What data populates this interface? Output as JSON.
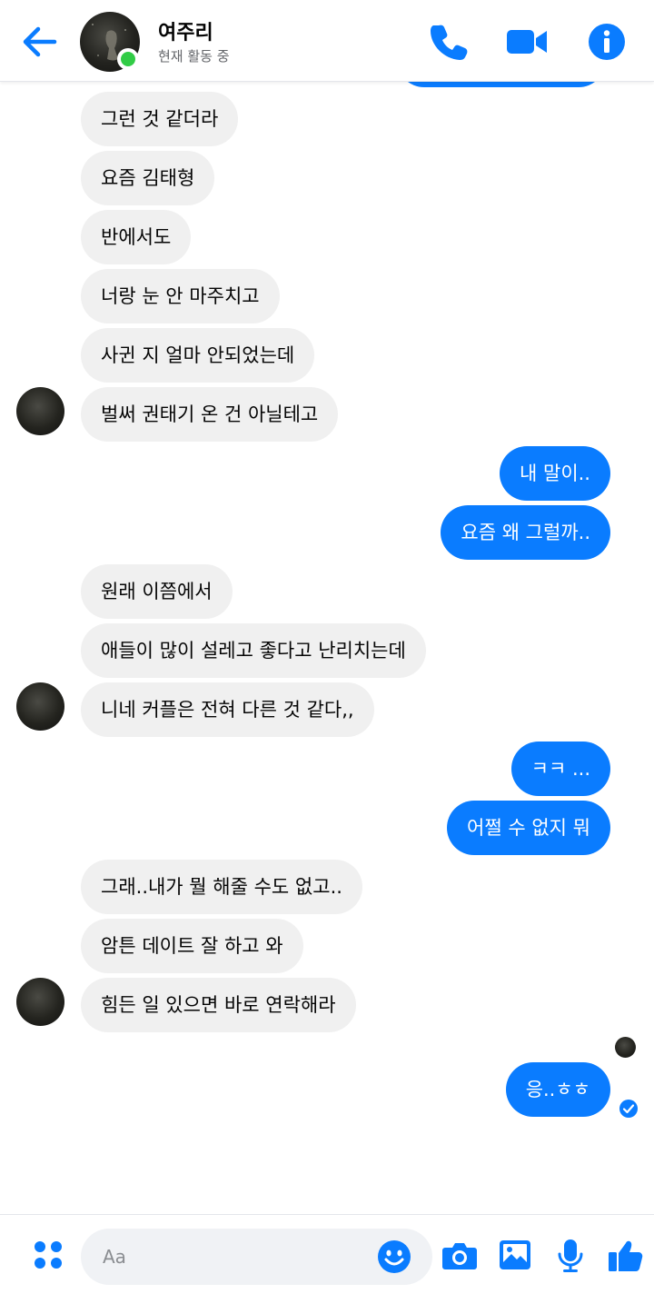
{
  "header": {
    "contact_name": "여주리",
    "status": "현재 활동 중"
  },
  "messages": [
    {
      "dir": "in",
      "text": "그런 것 같더라"
    },
    {
      "dir": "in",
      "text": "요즘 김태형"
    },
    {
      "dir": "in",
      "text": "반에서도"
    },
    {
      "dir": "in",
      "text": "너랑 눈 안 마주치고"
    },
    {
      "dir": "in",
      "text": "사귄 지 얼마 안되었는데"
    },
    {
      "dir": "in",
      "text": "벌써 권태기 온 건 아닐테고"
    },
    {
      "dir": "out",
      "text": "내 말이.."
    },
    {
      "dir": "out",
      "text": "요즘 왜 그럴까.."
    },
    {
      "dir": "in",
      "text": "원래 이쯤에서"
    },
    {
      "dir": "in",
      "text": "애들이 많이 설레고 좋다고 난리치는데"
    },
    {
      "dir": "in",
      "text": "니네 커플은 전혀 다른 것 같다,,"
    },
    {
      "dir": "out",
      "text": "ㅋㅋ ..."
    },
    {
      "dir": "out",
      "text": "어쩔 수 없지 뭐"
    },
    {
      "dir": "in",
      "text": "그래..내가 뭘 해줄 수도 없고.."
    },
    {
      "dir": "in",
      "text": "암튼 데이트 잘 하고 와"
    },
    {
      "dir": "in",
      "text": "힘든 일 있으면 바로 연락해라"
    },
    {
      "dir": "out",
      "text": "응..ㅎㅎ"
    }
  ],
  "composer": {
    "placeholder": "Aa"
  },
  "icons": {
    "back": "back-arrow-icon",
    "call": "phone-icon",
    "video": "video-camera-icon",
    "info": "info-icon",
    "menu": "four-dots-icon",
    "emoji": "smiley-icon",
    "camera": "camera-icon",
    "gallery": "image-icon",
    "mic": "microphone-icon",
    "like": "thumbs-up-icon"
  },
  "colors": {
    "accent": "#0a7cff",
    "incoming_bubble": "#f0f0f0",
    "online": "#31cc46"
  }
}
